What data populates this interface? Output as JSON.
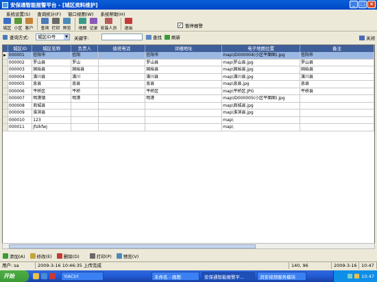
{
  "window": {
    "title": "安保通智能报警平台 - [城区资料维护]"
  },
  "menu": [
    "系统设置(S)",
    "查询统计(F)",
    "窗口视图(W)",
    "系统帮助(H)"
  ],
  "toolbar": [
    {
      "label": "城区",
      "icon": "region-icon",
      "color": "#3a6fc4"
    },
    {
      "label": "小区",
      "icon": "community-icon",
      "color": "#5a9a3c"
    },
    {
      "label": "客户",
      "icon": "customer-icon",
      "color": "#c4843a"
    },
    {
      "label": "查询",
      "icon": "query-icon",
      "color": "#4a7ab8"
    },
    {
      "label": "打印",
      "icon": "print-icon",
      "color": "#6a6a6a"
    },
    {
      "label": "预览",
      "icon": "preview-icon",
      "color": "#4a8ab8"
    },
    {
      "label": "地图",
      "icon": "map-icon",
      "color": "#3a9a8a"
    },
    {
      "label": "记录",
      "icon": "record-icon",
      "color": "#8a5ab8"
    },
    {
      "label": "安装人员",
      "icon": "installer-icon",
      "color": "#b85a5a"
    },
    {
      "label": "退出",
      "icon": "exit-icon",
      "color": "#c43a3a"
    }
  ],
  "pause_alarm": {
    "label": "暂停报警",
    "checked": true
  },
  "search": {
    "method_label": "查询方式:",
    "method_value": "城区ID号",
    "keyword_label": "关键字:",
    "keyword_value": "",
    "find_label": "查找",
    "refresh_label": "刷新",
    "close_label": "关闭"
  },
  "table": {
    "columns": [
      "城区ID",
      "城区名称",
      "负责人",
      "值班电话",
      "详细地址",
      "电子地图位置",
      "备注"
    ],
    "rows": [
      [
        "000001",
        "信阳市",
        "信阳",
        "",
        "信阳市",
        "map\\ID000004(小区平面图).jpg",
        "信阳市"
      ],
      [
        "000002",
        "罗山县",
        "罗山",
        "",
        "罗山县",
        "map\\罗山县.jpg",
        "罗山县"
      ],
      [
        "000003",
        "固始县",
        "固始县",
        "",
        "固始县",
        "map\\固始县.jpg",
        "固始县"
      ],
      [
        "000004",
        "潢川县",
        "潢川",
        "",
        "潢川县",
        "map\\潢川县.jpg",
        "潢川县"
      ],
      [
        "000005",
        "息县",
        "息县",
        "",
        "息县",
        "map\\息县.jpg",
        "息县"
      ],
      [
        "000006",
        "平桥区",
        "平桥",
        "",
        "平桥区",
        "map\\平桥区.JPG",
        "平桥县"
      ],
      [
        "000007",
        "明港镇",
        "明港",
        "",
        "明港",
        "map\\ID000005(小区平面图).jpg",
        ""
      ],
      [
        "000008",
        "商城县",
        "",
        "",
        "",
        "map\\商城县.jpg",
        ""
      ],
      [
        "000009",
        "淮滨县",
        "",
        "",
        "",
        "map\\淮滨县.jpg",
        ""
      ],
      [
        "000010",
        "123",
        "",
        "",
        "",
        "map\\",
        ""
      ],
      [
        "000011",
        "jfslkfwj",
        "",
        "",
        "",
        "map\\",
        ""
      ]
    ]
  },
  "actions": [
    {
      "label": "添加(A)",
      "icon": "add-icon",
      "color": "#3a9a3a"
    },
    {
      "label": "修改(E)",
      "icon": "edit-icon",
      "color": "#c4a43a"
    },
    {
      "label": "删除(D)",
      "icon": "delete-icon",
      "color": "#c43a3a"
    },
    {
      "label": "打印(P)",
      "icon": "print-icon",
      "color": "#6a6a6a"
    },
    {
      "label": "预览(V)",
      "icon": "preview-icon",
      "color": "#4a8ab8"
    }
  ],
  "status": {
    "user": "用户: sa",
    "message": "2009-3-16 10:46:35 上传完成",
    "coords": "140, 96",
    "date": "2009-3-16",
    "time": "10:47"
  },
  "taskbar": {
    "start": "开始",
    "tasks": [
      "YiACtrl",
      "未命名 - 画图",
      "安保通智能报警平...",
      "消安视频服务模块"
    ],
    "clock": "10:47"
  }
}
